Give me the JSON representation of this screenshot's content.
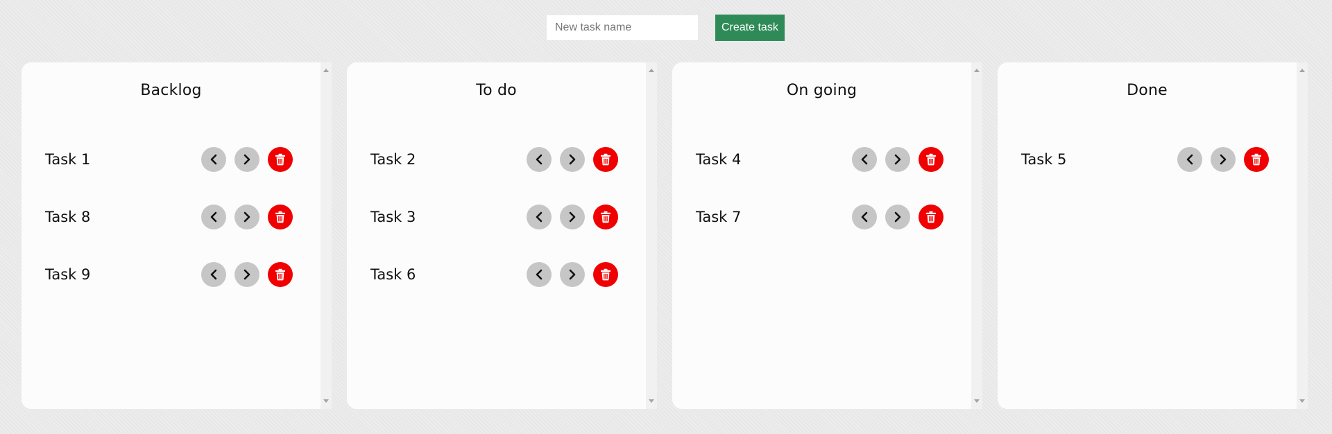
{
  "new_task": {
    "placeholder": "New task name",
    "value": "",
    "create_label": "Create task"
  },
  "icons": {
    "prev": "chevron-left-icon",
    "next": "chevron-right-icon",
    "delete": "trash-icon"
  },
  "colors": {
    "create_button": "#2e8b57",
    "delete_button": "#f00000",
    "nav_button": "#c6c6c6"
  },
  "columns": [
    {
      "id": "backlog",
      "title": "Backlog",
      "tasks": [
        "Task 1",
        "Task 8",
        "Task 9"
      ]
    },
    {
      "id": "todo",
      "title": "To do",
      "tasks": [
        "Task 2",
        "Task 3",
        "Task 6"
      ]
    },
    {
      "id": "ongoing",
      "title": "On going",
      "tasks": [
        "Task 4",
        "Task 7"
      ]
    },
    {
      "id": "done",
      "title": "Done",
      "tasks": [
        "Task 5"
      ]
    }
  ]
}
